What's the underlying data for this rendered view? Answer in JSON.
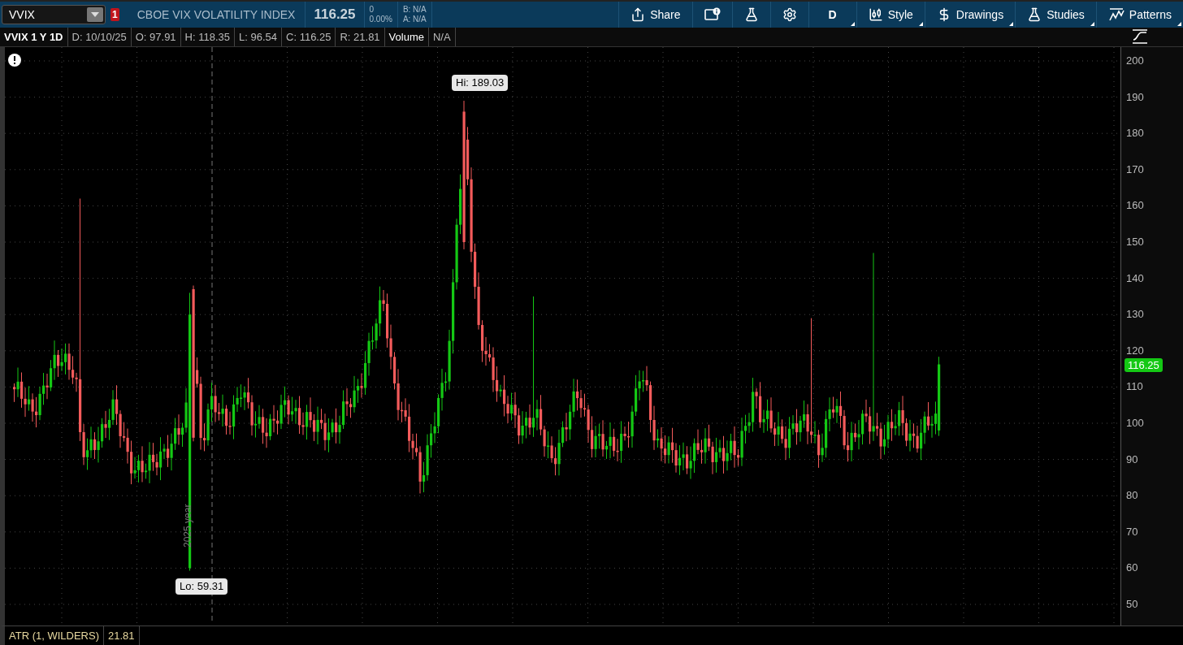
{
  "toolbar": {
    "symbol": "VVIX",
    "alert_count": "1",
    "description": "CBOE VIX VOLATILITY INDEX",
    "last": "116.25",
    "change": "0",
    "change_pct": "0.00%",
    "bid": "B: N/A",
    "ask": "A: N/A",
    "buttons": [
      {
        "kind": "share",
        "label": "Share",
        "has_menu": false
      },
      {
        "kind": "info",
        "has_menu": false
      },
      {
        "kind": "flask",
        "has_menu": false
      },
      {
        "kind": "gear",
        "has_menu": false
      },
      {
        "kind": "text",
        "label": "D",
        "has_menu": true
      },
      {
        "kind": "style",
        "label": "Style",
        "has_menu": true
      },
      {
        "kind": "drawings",
        "label": "Drawings",
        "has_menu": true
      },
      {
        "kind": "studies",
        "label": "Studies",
        "has_menu": true
      },
      {
        "kind": "patterns",
        "label": "Patterns",
        "has_menu": true
      }
    ]
  },
  "chart_header": [
    {
      "kind": "title",
      "text": "VVIX 1 Y 1D"
    },
    {
      "kind": "field",
      "text": "D: 10/10/25"
    },
    {
      "kind": "field",
      "text": "O: 97.91"
    },
    {
      "kind": "field",
      "text": "H: 118.35"
    },
    {
      "kind": "field",
      "text": "L: 96.54"
    },
    {
      "kind": "field",
      "text": "C: 116.25"
    },
    {
      "kind": "field",
      "text": "R: 21.81"
    },
    {
      "kind": "label",
      "text": "Volume"
    },
    {
      "kind": "field",
      "text": "N/A"
    }
  ],
  "chart": {
    "hi_label": "Hi: 189.03",
    "lo_label": "Lo: 59.31",
    "year_marker": "2025 year",
    "last_price": "116.25",
    "price_axis": [
      "200",
      "190",
      "180",
      "170",
      "160",
      "150",
      "140",
      "130",
      "120",
      "110",
      "100",
      "90",
      "80",
      "70",
      "60",
      "50"
    ]
  },
  "study": {
    "name": "ATR (1, WILDERS)",
    "value": "21.81"
  }
}
